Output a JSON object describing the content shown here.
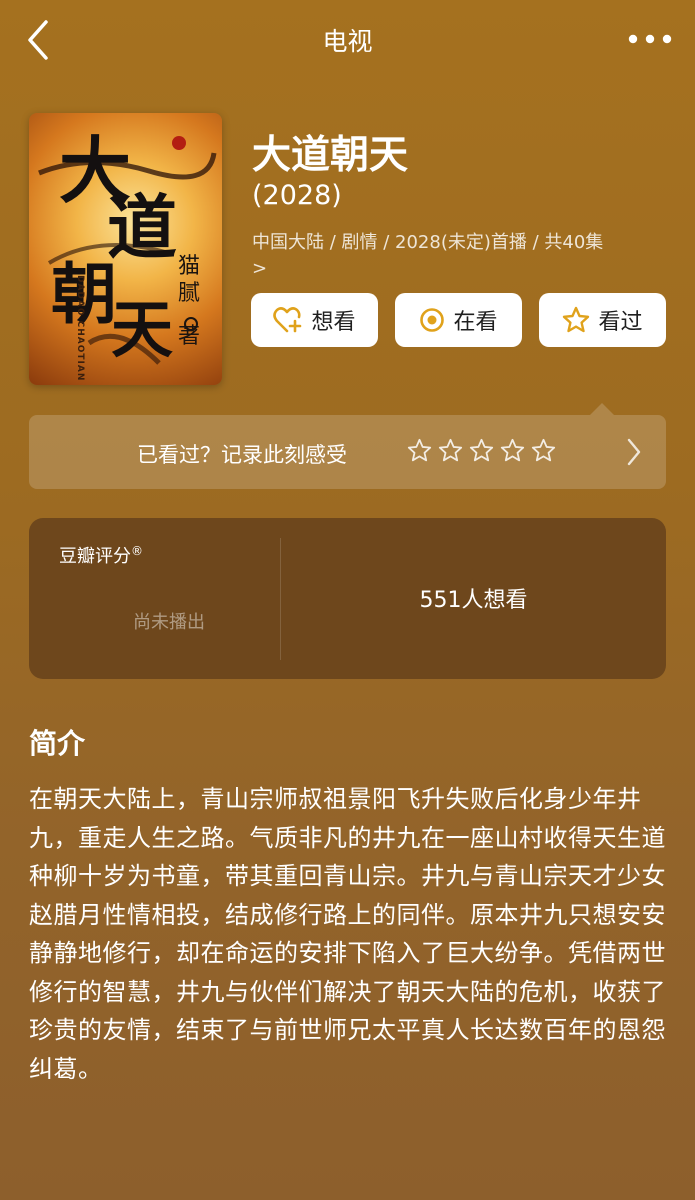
{
  "nav": {
    "title": "电视",
    "back_icon": "chevron-left-icon",
    "more_icon": "more-dots-icon"
  },
  "poster": {
    "calligraphy": [
      "大",
      "道",
      "朝",
      "天"
    ],
    "author": [
      "猫",
      "腻",
      "著"
    ],
    "pinyin": "DADAO CHAOTIAN"
  },
  "show": {
    "title": "大道朝天",
    "year": "(2028)",
    "meta": "中国大陆 / 剧情 / 2028(未定)首播 / 共40集",
    "meta_chevron": ">"
  },
  "actions": {
    "want_label": "想看",
    "watching_label": "在看",
    "watched_label": "看过"
  },
  "rating_prompt": {
    "text": "已看过？记录此刻感受",
    "star_count": 5
  },
  "score": {
    "label": "豆瓣评分",
    "registered_mark": "®",
    "status": "尚未播出",
    "want_count": "551人想看"
  },
  "intro": {
    "heading": "简介",
    "body": "在朝天大陆上，青山宗师叔祖景阳飞升失败后化身少年井九，重走人生之路。气质非凡的井九在一座山村收得天生道种柳十岁为书童，带其重回青山宗。井九与青山宗天才少女赵腊月性情相投，结成修行路上的同伴。原本井九只想安安静静地修行，却在命运的安排下陷入了巨大纷争。凭借两世修行的智慧，井九与伙伴们解决了朝天大陆的危机，收获了珍贵的友情，结束了与前世师兄太平真人长达数百年的恩怨纠葛。"
  },
  "colors": {
    "background": "#9d6b21",
    "card": "#6e471c",
    "button_bg": "#ffffff",
    "accent": "#e0a21b"
  }
}
